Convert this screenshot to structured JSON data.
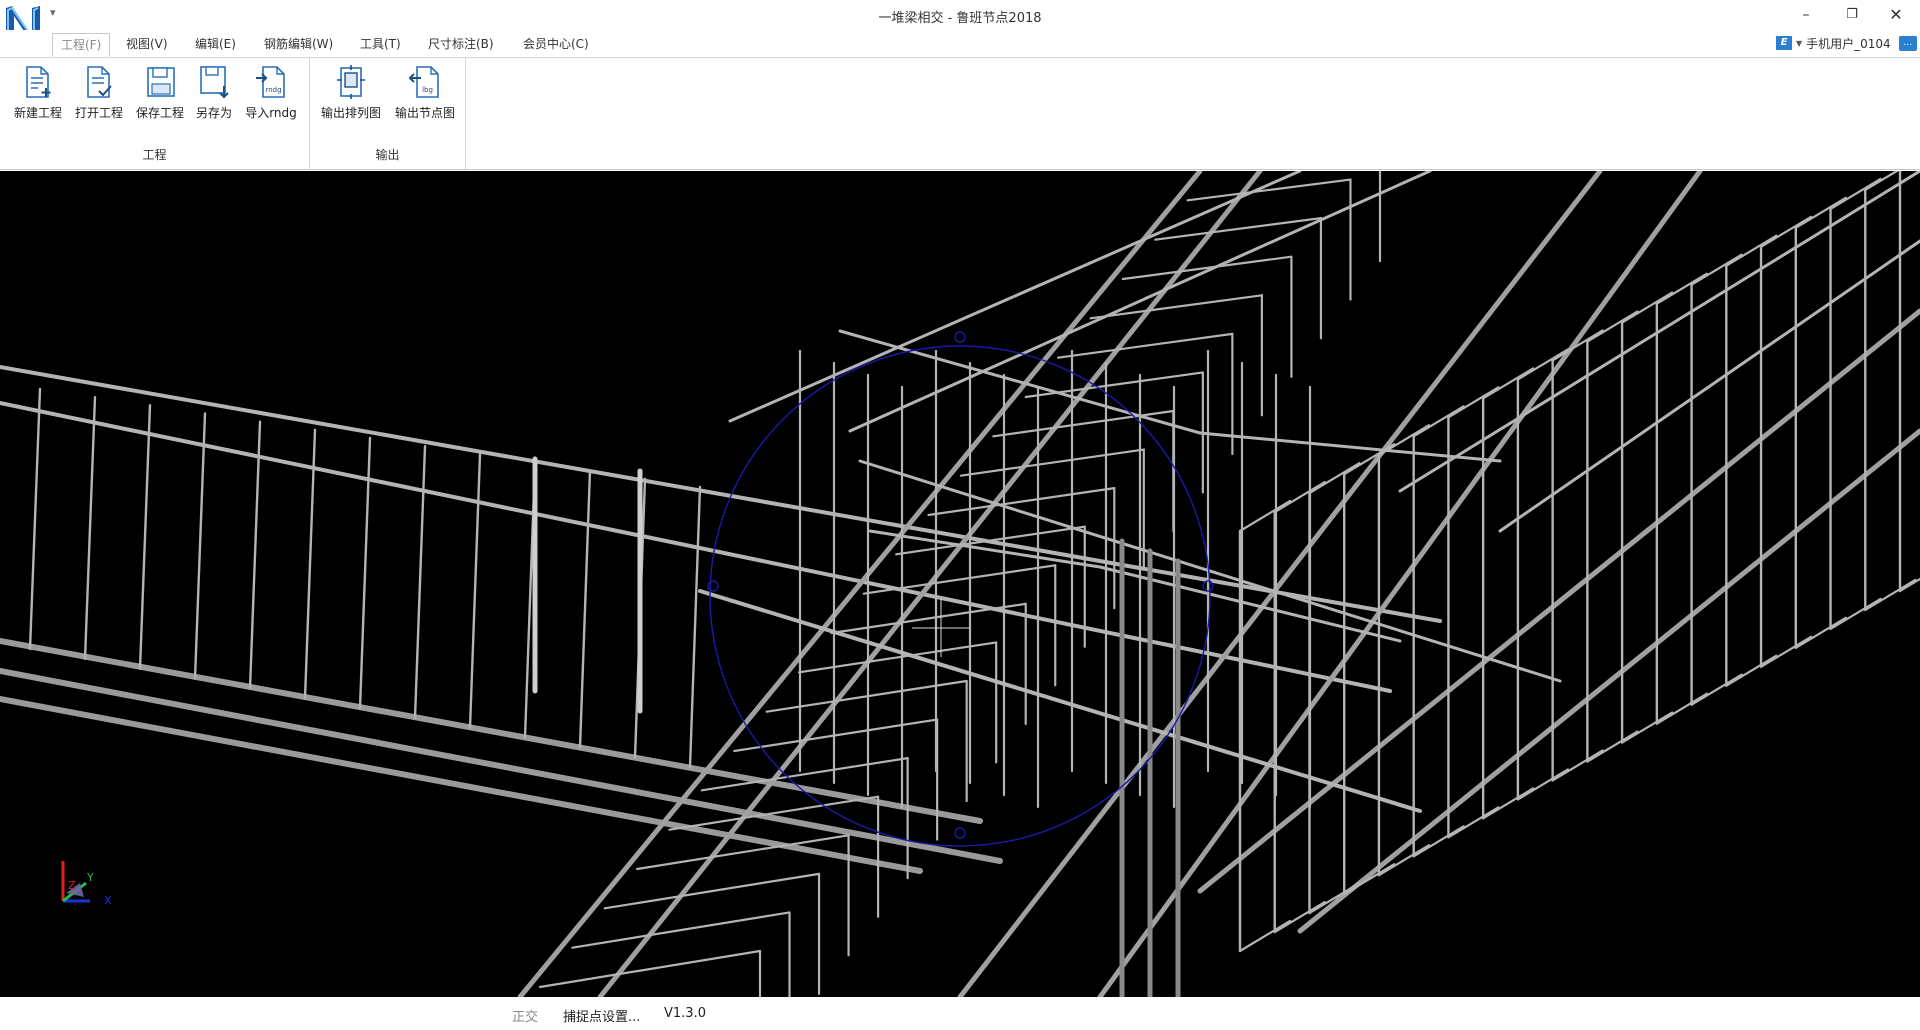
{
  "window": {
    "title": "一堆梁相交 - 鲁班节点2018",
    "minimize_glyph": "–",
    "restore_glyph": "❐",
    "close_glyph": "✕"
  },
  "menu": {
    "tabs": [
      {
        "label": "工程(F)",
        "active": true
      },
      {
        "label": "视图(V)"
      },
      {
        "label": "编辑(E)"
      },
      {
        "label": "钢筋编辑(W)"
      },
      {
        "label": "工具(T)"
      },
      {
        "label": "尺寸标注(B)"
      },
      {
        "label": "会员中心(C)"
      }
    ]
  },
  "user": {
    "name": "手机用户_0104",
    "e_icon": "E"
  },
  "ribbon": {
    "groups": [
      {
        "label": "工程",
        "buttons": [
          {
            "label": "新建工程",
            "icon": "new-project-icon"
          },
          {
            "label": "打开工程",
            "icon": "open-project-icon"
          },
          {
            "label": "保存工程",
            "icon": "save-project-icon"
          },
          {
            "label": "另存为",
            "icon": "save-as-icon"
          },
          {
            "label": "导入rndg",
            "icon": "import-rndg-icon",
            "icon_text": "rndg"
          }
        ]
      },
      {
        "label": "输出",
        "buttons": [
          {
            "label": "输出排列图",
            "icon": "export-layout-icon"
          },
          {
            "label": "输出节点图",
            "icon": "export-node-icon",
            "icon_text": "lbg"
          }
        ]
      }
    ]
  },
  "axes": {
    "x": "X",
    "y": "Y",
    "z": "Z"
  },
  "status": {
    "ortho": "正交",
    "snap": "捕捉点设置...",
    "version": "V1.3.0"
  },
  "colors": {
    "viewport_bg": "#000000",
    "rebar": "#b4b4b4",
    "snap_circle": "#1a1aa6",
    "accent": "#2a7fd0"
  }
}
